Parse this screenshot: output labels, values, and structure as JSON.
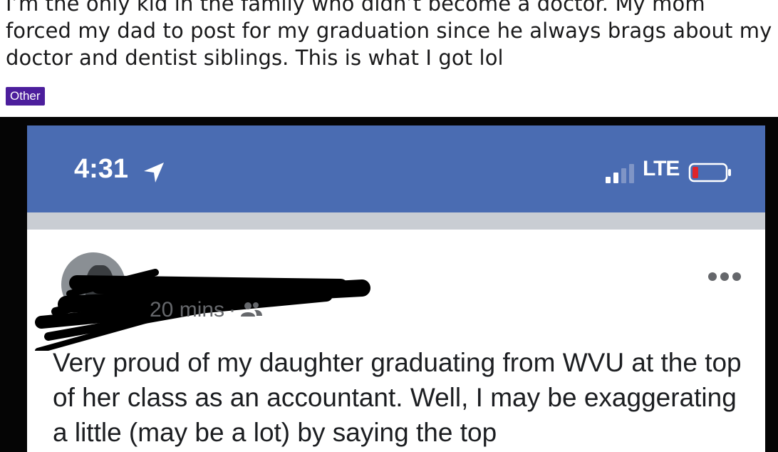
{
  "reddit": {
    "title": "I’m the only kid in the family who didn’t become a doctor. My mom forced my dad to post for my graduation since he always brags about my doctor and dentist siblings. This is what I got lol",
    "flair": "Other",
    "flair_color": "#4c1e9c"
  },
  "phone": {
    "status_bar": {
      "time": "4:31",
      "network": "LTE",
      "color": "#4a6cb2",
      "icons": [
        "location-arrow-icon",
        "signal-icon",
        "battery-low-icon"
      ]
    },
    "post": {
      "timestamp": "20 mins",
      "separator": "·",
      "audience_icon": "friends-icon",
      "more_icon": "more-options-icon",
      "body": "Very proud of my daughter graduating from WVU at the top of her class as an accountant. Well, I may be exaggerating a little (may be a lot) by saying the top"
    }
  }
}
